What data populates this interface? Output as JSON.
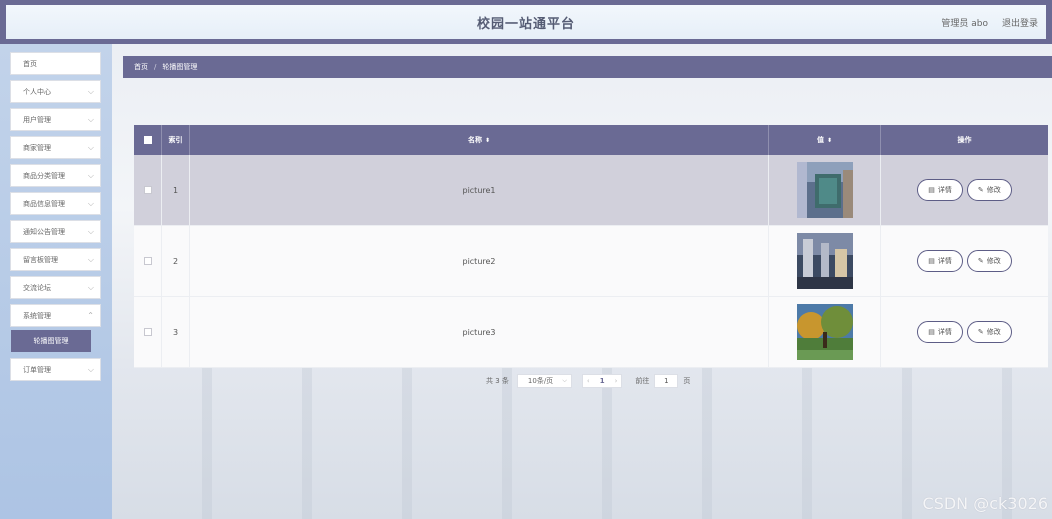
{
  "header": {
    "title": "校园一站通平台",
    "user_label": "管理员 abo",
    "logout_label": "退出登录"
  },
  "sidebar": {
    "items": [
      {
        "label": "首页",
        "has_chevron": false
      },
      {
        "label": "个人中心",
        "has_chevron": true
      },
      {
        "label": "用户管理",
        "has_chevron": true
      },
      {
        "label": "商家管理",
        "has_chevron": true
      },
      {
        "label": "商品分类管理",
        "has_chevron": true
      },
      {
        "label": "商品信息管理",
        "has_chevron": true
      },
      {
        "label": "通知公告管理",
        "has_chevron": true
      },
      {
        "label": "留言板管理",
        "has_chevron": true
      },
      {
        "label": "交流论坛",
        "has_chevron": true
      },
      {
        "label": "系统管理",
        "has_chevron": true
      }
    ],
    "active_sub": "轮播图管理",
    "after_items": [
      {
        "label": "订单管理",
        "has_chevron": true
      }
    ]
  },
  "breadcrumb": {
    "home": "首页",
    "separator": "/",
    "current": "轮播图管理"
  },
  "table": {
    "headers": {
      "index": "索引",
      "name": "名称",
      "value": "值",
      "actions": "操作"
    },
    "rows": [
      {
        "index": "1",
        "name": "picture1"
      },
      {
        "index": "2",
        "name": "picture2"
      },
      {
        "index": "3",
        "name": "picture3"
      }
    ],
    "detail_label": "详情",
    "edit_label": "修改"
  },
  "pagination": {
    "total": "共 3 条",
    "page_size": "10条/页",
    "prev": "‹",
    "current_page": "1",
    "next": "›",
    "goto_label": "前往",
    "goto_value": "1",
    "page_suffix": "页"
  },
  "watermark": "CSDN @ck3026",
  "colors": {
    "primary": "#6a6a94",
    "hover_row": "#d1d0db"
  }
}
